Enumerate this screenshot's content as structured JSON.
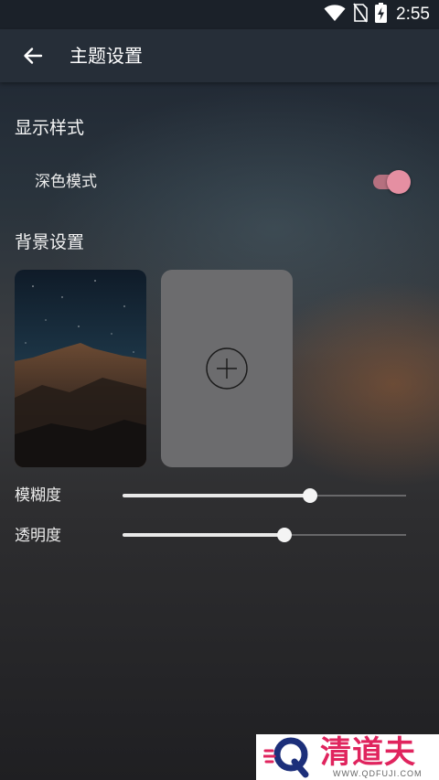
{
  "status_bar": {
    "time": "2:55",
    "icons": [
      "wifi-icon",
      "no-sim-icon",
      "battery-charging-icon"
    ]
  },
  "app_bar": {
    "back_icon": "arrow-left-icon",
    "title": "主题设置"
  },
  "display_style": {
    "section_title": "显示样式",
    "dark_mode_label": "深色模式",
    "dark_mode_on": true,
    "accent_color": "#e58fa2"
  },
  "background": {
    "section_title": "背景设置",
    "add_icon": "plus-circle-icon"
  },
  "sliders": {
    "blur": {
      "label": "模糊度",
      "value_fraction": 0.66
    },
    "transparency": {
      "label": "透明度",
      "value_fraction": 0.57
    }
  },
  "watermark": {
    "text": "清道夫",
    "sub": "WWW.QDFUJI.COM"
  }
}
